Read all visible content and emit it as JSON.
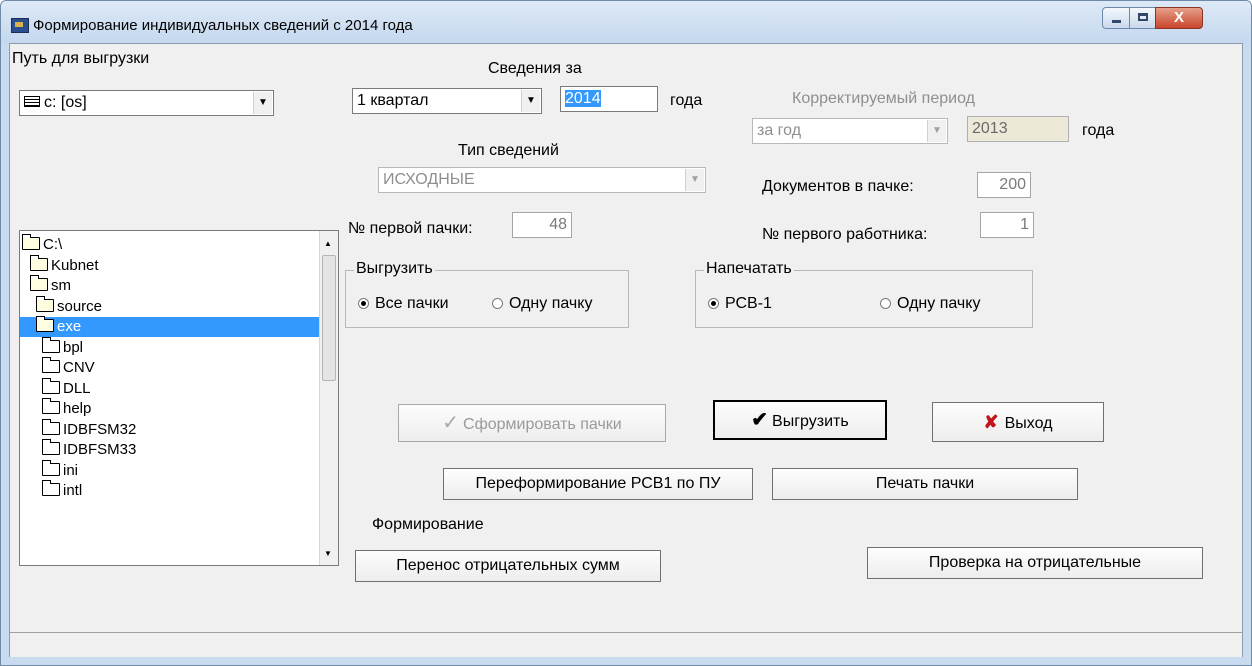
{
  "window": {
    "title": "Формирование индивидуальных сведений  с 2014 года",
    "close_glyph": "X"
  },
  "left": {
    "path_label": "Путь для выгрузки",
    "drive_value": "c: [os]",
    "tree": [
      {
        "label": "C:\\",
        "level": 0,
        "open": true
      },
      {
        "label": "Kubnet",
        "level": 1,
        "open": true
      },
      {
        "label": "sm",
        "level": 1,
        "open": true
      },
      {
        "label": "source",
        "level": 2,
        "open": true
      },
      {
        "label": "exe",
        "level": 2,
        "open": true,
        "selected": true
      },
      {
        "label": "bpl",
        "level": 3
      },
      {
        "label": "CNV",
        "level": 3
      },
      {
        "label": "DLL",
        "level": 3
      },
      {
        "label": "help",
        "level": 3
      },
      {
        "label": "IDBFSM32",
        "level": 3
      },
      {
        "label": "IDBFSM33",
        "level": 3
      },
      {
        "label": "ini",
        "level": 3
      },
      {
        "label": "intl",
        "level": 3
      }
    ]
  },
  "period": {
    "label": "Сведения за",
    "quarter_value": "1 квартал",
    "year_value": "2014",
    "year_suffix": "года"
  },
  "correction": {
    "label": "Корректируемый период",
    "period_value": "за год",
    "year_value": "2013",
    "year_suffix": "года"
  },
  "type": {
    "label": "Тип сведений",
    "value": "ИСХОДНЫЕ"
  },
  "docs_per_pack": {
    "label": "Документов в пачке:",
    "value": "200"
  },
  "first_pack": {
    "label": "№ первой пачки:",
    "value": "48"
  },
  "first_worker": {
    "label": "№ первого работника:",
    "value": "1"
  },
  "export_group": {
    "title": "Выгрузить",
    "opt_all": "Все пачки",
    "opt_one": "Одну пачку",
    "selected": "all"
  },
  "print_group": {
    "title": "Напечатать",
    "opt_rsv": "РСВ-1",
    "opt_one": "Одну пачку",
    "selected": "rsv"
  },
  "buttons": {
    "form_packs": "Сформировать пачки",
    "export": "Выгрузить",
    "exit": "Выход",
    "reform": "Переформирование РСВ1 по ПУ",
    "print_pack": "Печать пачки",
    "forming_label": "Формирование",
    "transfer_negative": "Перенос отрицательных сумм",
    "check_negative": "Проверка на отрицательные"
  },
  "icons": {
    "app": "app-icon",
    "drive": "drive-icon",
    "folder": "folder-icon",
    "check": "check-icon",
    "cross": "cross-icon"
  },
  "colors": {
    "selection": "#3399ff",
    "exit_icon": "#c0181a"
  }
}
